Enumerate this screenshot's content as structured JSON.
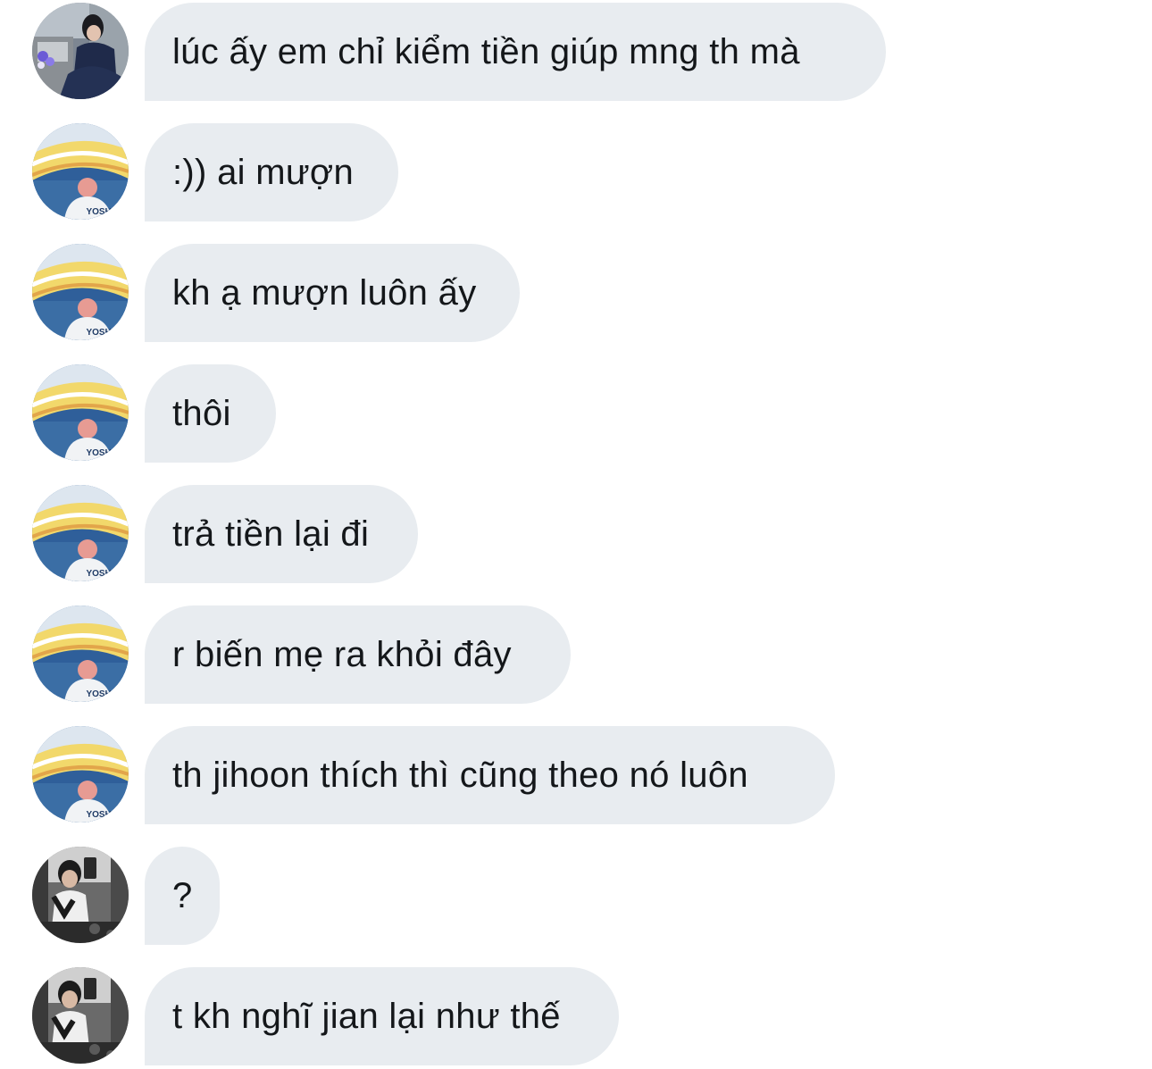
{
  "messages": [
    {
      "sender": "a",
      "text": "lúc ấy em chỉ kiểm tiền giúp mng th mà"
    },
    {
      "sender": "b",
      "text": ":)) ai mượn"
    },
    {
      "sender": "b",
      "text": "kh ạ mượn luôn ấy"
    },
    {
      "sender": "b",
      "text": "thôi"
    },
    {
      "sender": "b",
      "text": "trả tiền lại đi"
    },
    {
      "sender": "b",
      "text": "r biến mẹ ra khỏi đây"
    },
    {
      "sender": "b",
      "text": "th jihoon thích thì cũng theo nó luôn"
    },
    {
      "sender": "c",
      "text": "?"
    },
    {
      "sender": "c",
      "text": "t kh nghĩ jian lại như thế"
    }
  ],
  "avatars": {
    "yoshi_shirt_text": "YOSHI"
  },
  "colors": {
    "bubble_background": "#e8ecf0",
    "message_text": "#14171a",
    "page_background": "#ffffff"
  }
}
